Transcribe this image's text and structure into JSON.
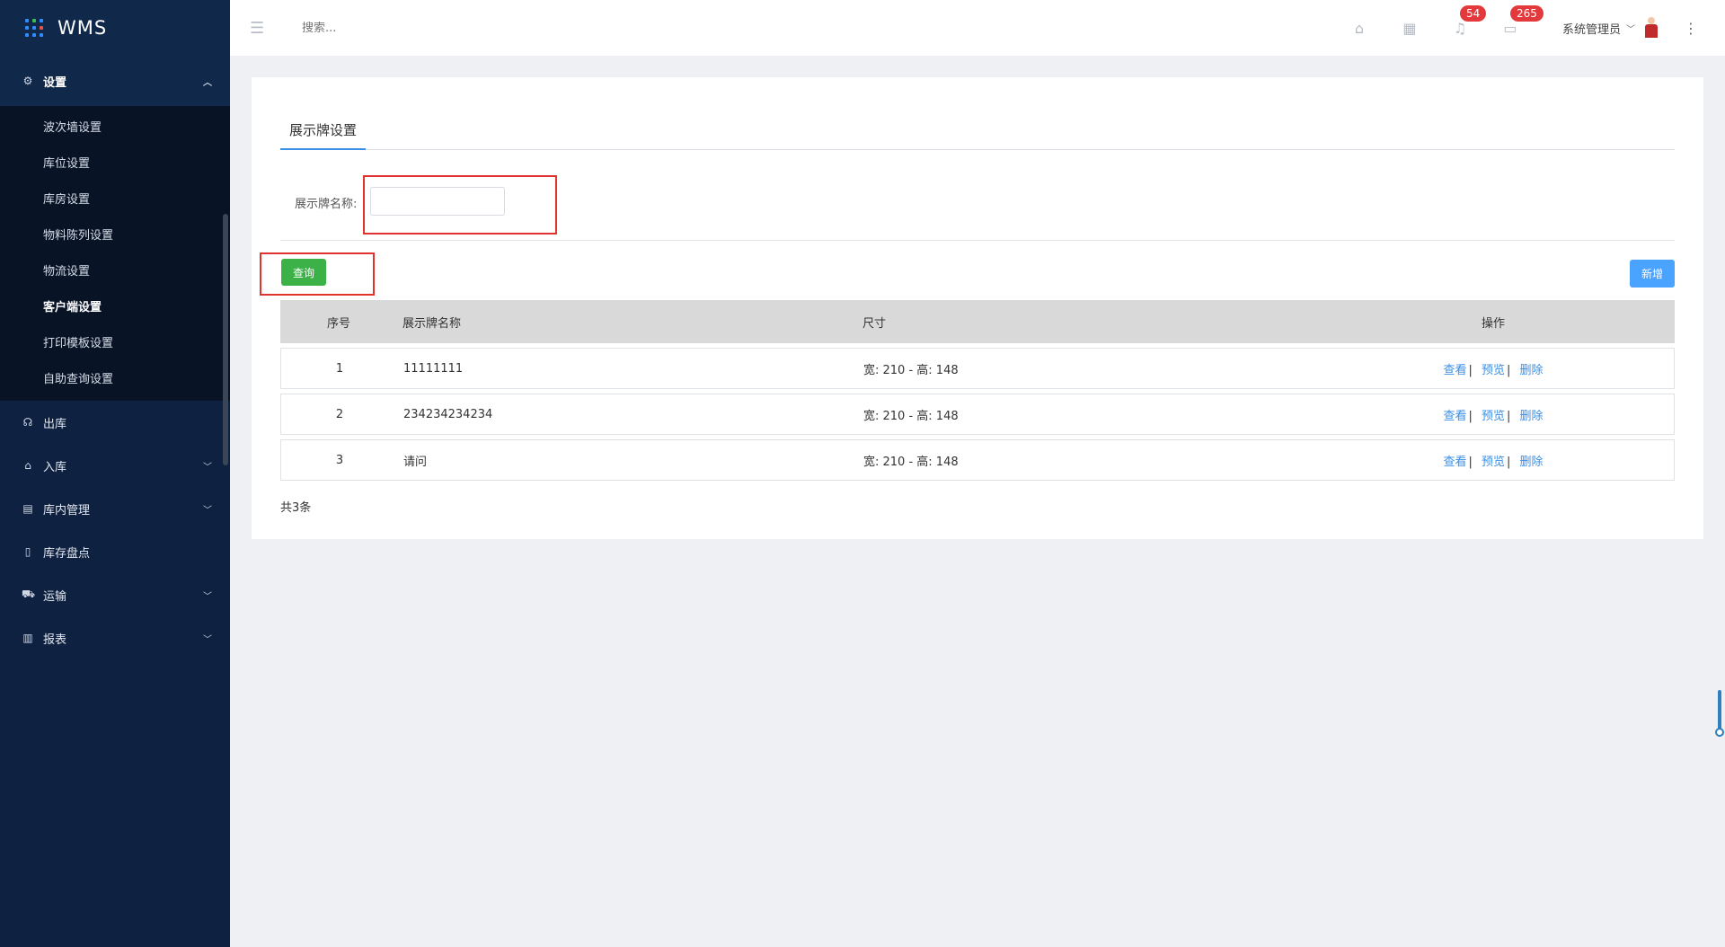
{
  "app": {
    "title": "WMS"
  },
  "sidebar": {
    "settings_group": {
      "label": "设置",
      "items": [
        {
          "label": "波次墙设置"
        },
        {
          "label": "库位设置"
        },
        {
          "label": "库房设置"
        },
        {
          "label": "物料陈列设置"
        },
        {
          "label": "物流设置"
        },
        {
          "label": "客户端设置",
          "active": true
        },
        {
          "label": "打印模板设置"
        },
        {
          "label": "自助查询设置"
        }
      ]
    },
    "items": [
      {
        "label": "出库",
        "icon": "headset-icon",
        "expandable": false
      },
      {
        "label": "入库",
        "icon": "home-icon",
        "expandable": true
      },
      {
        "label": "库内管理",
        "icon": "box-icon",
        "expandable": true
      },
      {
        "label": "库存盘点",
        "icon": "clipboard-icon",
        "expandable": false
      },
      {
        "label": "运输",
        "icon": "truck-icon",
        "expandable": true
      },
      {
        "label": "报表",
        "icon": "bar-chart-icon",
        "expandable": true
      }
    ]
  },
  "header": {
    "search_placeholder": "搜索...",
    "notifications_count": "54",
    "messages_count": "265",
    "user_name": "系统管理员"
  },
  "page": {
    "tab_label": "展示牌设置",
    "filter_label": "展示牌名称:",
    "filter_value": "",
    "query_button": "查询",
    "add_button": "新增",
    "table": {
      "columns": [
        "序号",
        "展示牌名称",
        "尺寸",
        "操作"
      ],
      "rows": [
        {
          "index": "1",
          "name": "11111111",
          "size": "宽: 210 - 高: 148"
        },
        {
          "index": "2",
          "name": "234234234234",
          "size": "宽: 210 - 高: 148"
        },
        {
          "index": "3",
          "name": "请问",
          "size": "宽: 210 - 高: 148"
        }
      ],
      "actions": {
        "view": "查看",
        "preview": "预览",
        "delete": "删除",
        "separator": "|"
      }
    },
    "total_text": "共3条"
  },
  "colors": {
    "sidebar_bg": "#0f2140",
    "query_button": "#3bb147",
    "add_button": "#4aa3ff",
    "highlight_box": "#e0322f",
    "link": "#3a8ee6",
    "badge": "#e4393c"
  }
}
